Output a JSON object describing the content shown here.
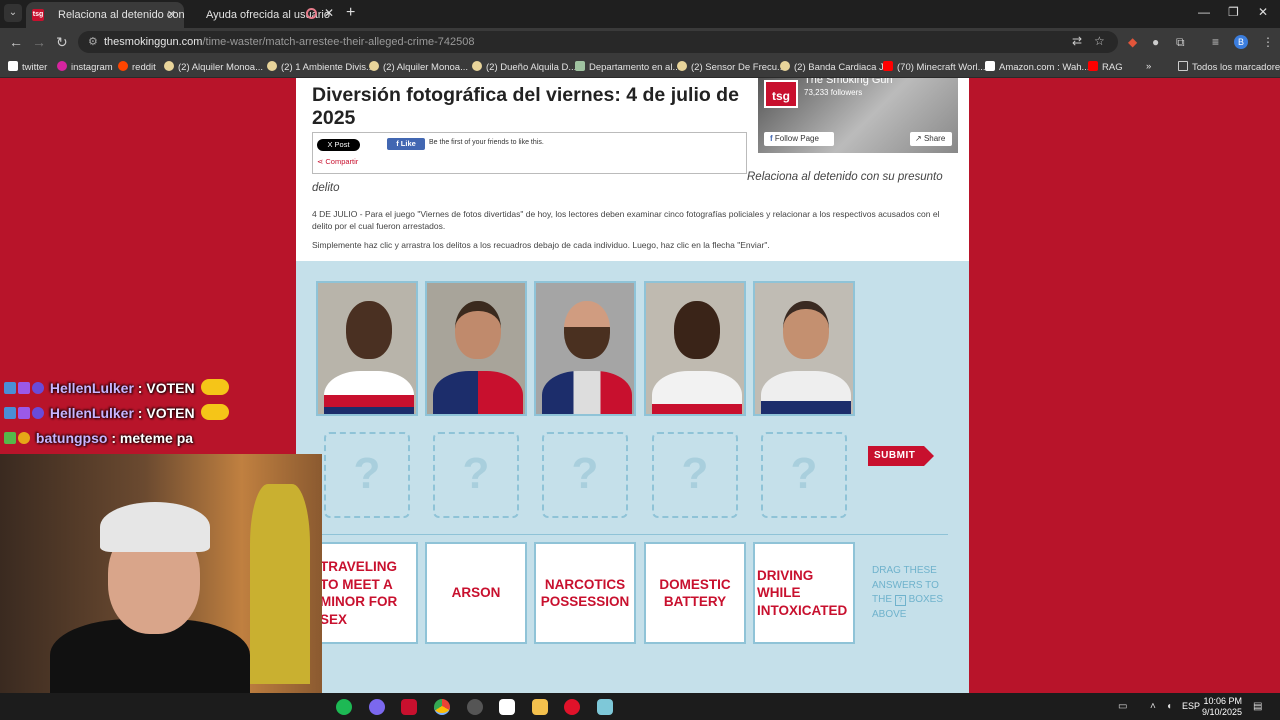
{
  "browser": {
    "tabs": [
      {
        "title": "Relaciona al detenido con su pr",
        "favicon": "tsg"
      },
      {
        "title": "Ayuda ofrecida al usuario"
      }
    ],
    "url_domain": "thesmokinggun.com",
    "url_path": "/time-waster/match-arrestee-their-alleged-crime-742508",
    "bookmarks": [
      "twitter",
      "instagram",
      "reddit",
      "(2) Alquiler Monoa...",
      "(2) 1 Ambiente Divis...",
      "(2) Alquiler Monoa...",
      "(2) Dueño Alquila D...",
      "Departamento en al...",
      "(2) Sensor De Frecu...",
      "(2) Banda Cardiaca J...",
      "(70) Minecraft Worl...",
      "Amazon.com : Wah...",
      "RAG"
    ],
    "all_bookmarks": "Todos los marcadores",
    "profile_initial": "B"
  },
  "article": {
    "title": "Diversión fotográfica del viernes: 4 de julio de 2025",
    "post_label": "X Post",
    "like_label": "Like",
    "like_text": "Be the first of your friends to like this.",
    "share_label": "Compartir",
    "caption_line1": "Relaciona al detenido con su presunto",
    "caption_line2": "delito",
    "intro": "4 DE JULIO - Para el juego \"Viernes de fotos divertidas\" de hoy, los lectores deben examinar cinco fotografías policiales y relacionar a los respectivos acusados con el delito por el cual fueron arrestados.",
    "instructions": "Simplemente haz clic y arrastra los delitos a los recuadros debajo de cada individuo. Luego, haz clic en la flecha \"Enviar\"."
  },
  "fb_widget": {
    "logo": "tsg",
    "page_name": "The Smoking Gun",
    "followers": "73,233 followers",
    "follow_label": "Follow Page",
    "share_label": "Share"
  },
  "game": {
    "drop_placeholder": "?",
    "submit_label": "SUBMIT",
    "answers": [
      "TRAVELING TO MEET A MINOR FOR SEX",
      "ARSON",
      "NARCOTICS POSSESSION",
      "DOMESTIC BATTERY",
      "DRIVING WHILE INTOXICATED"
    ],
    "drag_note_1": "DRAG THESE ANSWERS TO THE",
    "drag_note_2": "BOXES ABOVE"
  },
  "chat": [
    {
      "user": "HellenLulker",
      "message": "VOTEN"
    },
    {
      "user": "HellenLulker",
      "message": "VOTEN"
    },
    {
      "user": "batungpso",
      "message": "meteme pa"
    }
  ],
  "taskbar": {
    "lang": "ESP",
    "time": "10:06 PM",
    "date": "9/10/2025"
  },
  "colors": {
    "brand_red": "#c8102e",
    "page_bg": "#b8142a",
    "game_bg": "#c5e0ea"
  }
}
